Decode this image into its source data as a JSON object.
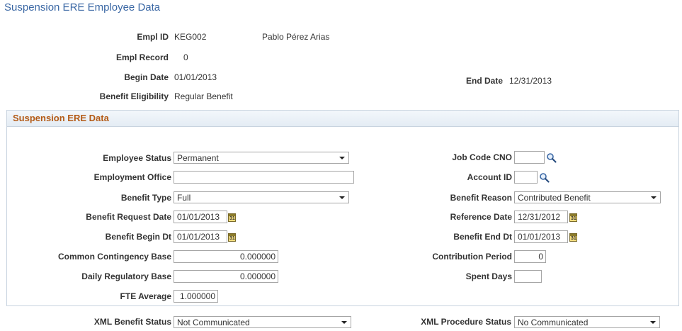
{
  "page_title": "Suspension ERE Employee Data",
  "header": {
    "empl_id_label": "Empl ID",
    "empl_id": "KEG002",
    "employee_name": "Pablo Pérez Arias",
    "empl_record_label": "Empl Record",
    "empl_record": "0",
    "begin_date_label": "Begin Date",
    "begin_date": "01/01/2013",
    "end_date_label": "End Date",
    "end_date": "12/31/2013",
    "benefit_eligibility_label": "Benefit Eligibility",
    "benefit_eligibility": "Regular Benefit"
  },
  "section": {
    "title": "Suspension ERE Data",
    "employee_status_label": "Employee Status",
    "employee_status": "Permanent",
    "employment_office_label": "Employment Office",
    "employment_office": "",
    "benefit_type_label": "Benefit Type",
    "benefit_type": "Full",
    "benefit_request_date_label": "Benefit Request Date",
    "benefit_request_date": "01/01/2013",
    "benefit_begin_dt_label": "Benefit Begin Dt",
    "benefit_begin_dt": "01/01/2013",
    "common_contingency_base_label": "Common Contingency Base",
    "common_contingency_base": "0.000000",
    "daily_regulatory_base_label": "Daily Regulatory Base",
    "daily_regulatory_base": "0.000000",
    "fte_average_label": "FTE Average",
    "fte_average": "1.000000",
    "job_code_cno_label": "Job Code CNO",
    "job_code_cno": "",
    "account_id_label": "Account ID",
    "account_id": "",
    "benefit_reason_label": "Benefit Reason",
    "benefit_reason": "Contributed Benefit",
    "reference_date_label": "Reference Date",
    "reference_date": "12/31/2012",
    "benefit_end_dt_label": "Benefit End Dt",
    "benefit_end_dt": "01/01/2013",
    "contribution_period_label": "Contribution Period",
    "contribution_period": "0",
    "spent_days_label": "Spent Days",
    "spent_days": ""
  },
  "footer": {
    "xml_benefit_status_label": "XML Benefit Status",
    "xml_benefit_status": "Not Communicated",
    "xml_procedure_status_label": "XML Procedure Status",
    "xml_procedure_status": "No Communicated"
  },
  "icons": {
    "calendar_day": "31",
    "lookup": "magnifier-icon",
    "calendar": "calendar-icon",
    "dropdown": "chevron-down-icon"
  }
}
